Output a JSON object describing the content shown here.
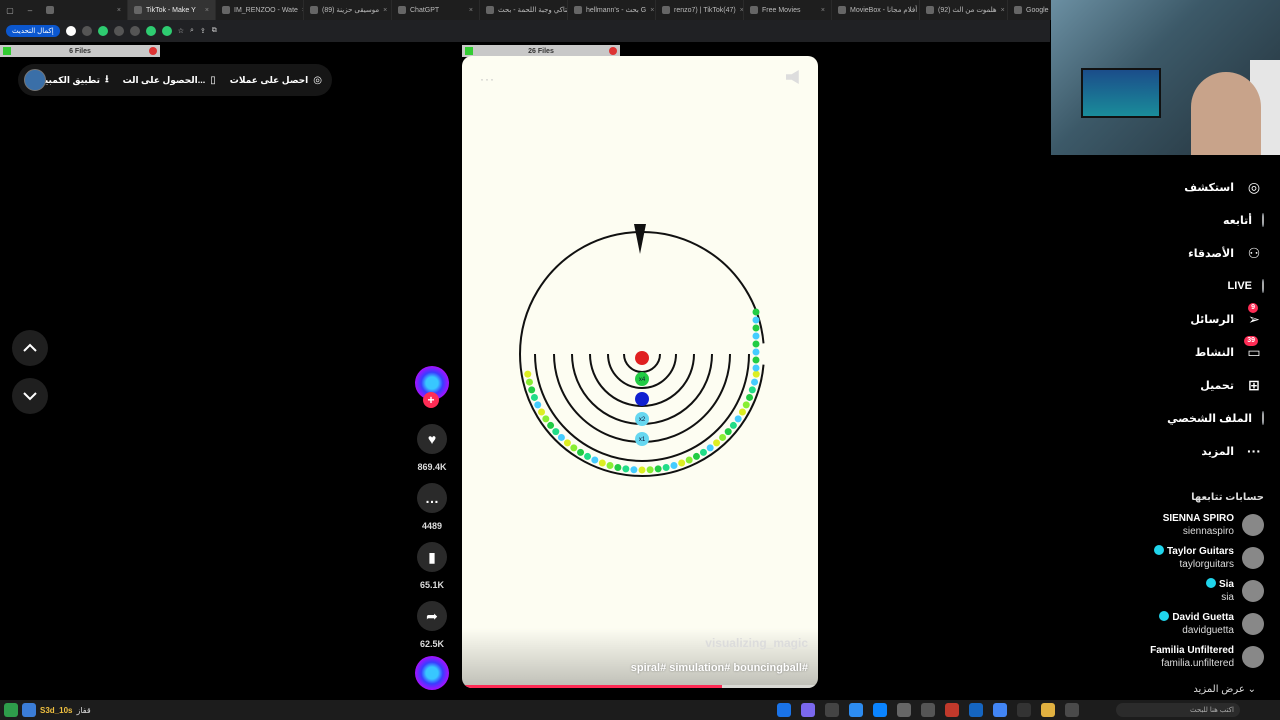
{
  "browser": {
    "tabs": [
      {
        "label": "",
        "active": false
      },
      {
        "label": "TikTok - Make Y",
        "active": true
      },
      {
        "label": "IM_RENZOO - Wate",
        "active": false
      },
      {
        "label": "(89) موسيقى حزينة",
        "active": false
      },
      {
        "label": "ChatGPT",
        "active": false
      },
      {
        "label": "كنتاكي وجبة اللحمة - بحث",
        "active": false
      },
      {
        "label": "hellmann's - بحث G",
        "active": false
      },
      {
        "label": "renzo7) | TikTok(47)",
        "active": false
      },
      {
        "label": "Free Movies",
        "active": false
      },
      {
        "label": "MovieBox - أفلام مجانا",
        "active": false
      },
      {
        "label": "(92) هلموت من الث",
        "active": false
      },
      {
        "label": "Google",
        "active": false
      }
    ],
    "update_button": "إكمال التحديث",
    "downloads": [
      {
        "label": "6 Files"
      },
      {
        "label": "26 Files"
      }
    ]
  },
  "header": {
    "items": [
      {
        "label": "احصل على عملات",
        "icon": "coin-icon"
      },
      {
        "label": "الحصول على الت...",
        "icon": "phone-icon"
      },
      {
        "label": "تطبيق الكمبيوتر",
        "icon": "download-icon"
      }
    ]
  },
  "video": {
    "more_icon": "···",
    "watermark": "visualizing_magic",
    "caption": "spiral# simulation# bouncingball#",
    "progress": 0.73,
    "sim": {
      "ball_labels": [
        "x4",
        "x2",
        "x1"
      ],
      "colors": {
        "red": "#e02020",
        "green": "#22cc44",
        "blue": "#1020d0",
        "cyan": "#66d7f0"
      }
    }
  },
  "actions": {
    "likes": "869.4K",
    "comments": "4489",
    "saves": "65.1K",
    "shares": "62.5K"
  },
  "sidebar": {
    "items": [
      {
        "label": "استكشف",
        "icon": "compass-icon"
      },
      {
        "label": "أتابعه",
        "icon": "following-avatar"
      },
      {
        "label": "الأصدقاء",
        "icon": "friends-icon"
      },
      {
        "label": "LIVE",
        "icon": "live-avatar"
      },
      {
        "label": "الرسائل",
        "icon": "send-icon",
        "badge": "9"
      },
      {
        "label": "النشاط",
        "icon": "inbox-icon",
        "badge": "39"
      },
      {
        "label": "تحميل",
        "icon": "upload-icon"
      },
      {
        "label": "الملف الشخصي",
        "icon": "profile-avatar"
      },
      {
        "label": "المزيد",
        "icon": "more-icon"
      }
    ],
    "following_title": "حسابات تتابعها",
    "accounts": [
      {
        "name": "SIENNA SPIRO",
        "handle": "siennaspiro",
        "verified": false
      },
      {
        "name": "Taylor Guitars",
        "handle": "taylorguitars",
        "verified": true
      },
      {
        "name": "Sia",
        "handle": "sia",
        "verified": true
      },
      {
        "name": "David Guetta",
        "handle": "davidguetta",
        "verified": true
      },
      {
        "name": "Familia Unfiltered",
        "handle": "familia.unfiltered",
        "verified": false
      }
    ],
    "see_more": "عرض المزيد"
  },
  "taskbar": {
    "left_text": "S3d_10s",
    "left_sub": "قفاز",
    "search_placeholder": "اكتب هنا للبحث"
  }
}
